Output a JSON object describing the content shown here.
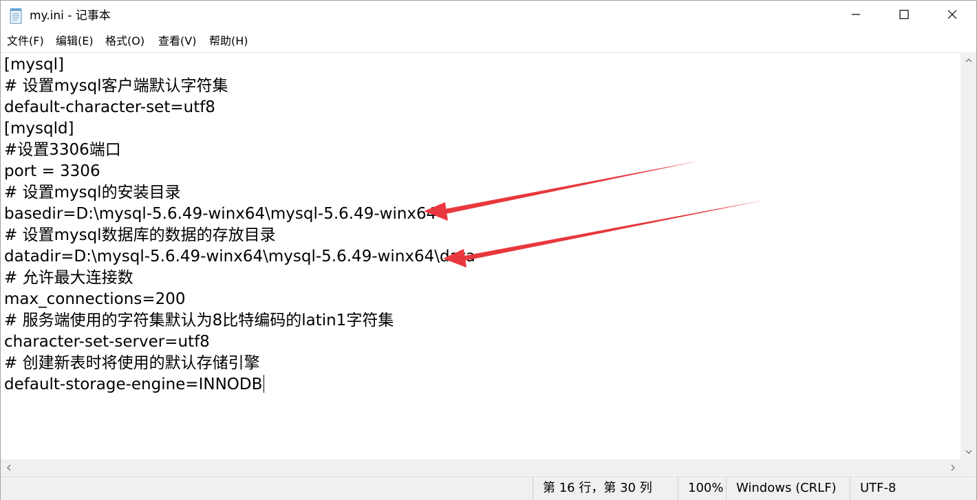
{
  "window": {
    "title": "my.ini - 记事本",
    "icon": "notepad-icon",
    "controls": [
      "minimize-icon",
      "maximize-icon",
      "close-icon"
    ]
  },
  "menu": {
    "items": [
      {
        "label": "文件(F)"
      },
      {
        "label": "编辑(E)"
      },
      {
        "label": "格式(O)"
      },
      {
        "label": "查看(V)"
      },
      {
        "label": "帮助(H)"
      }
    ]
  },
  "editor": {
    "lines": [
      "[mysql]",
      "# 设置mysql客户端默认字符集",
      "default-character-set=utf8",
      "[mysqld]",
      "#设置3306端口",
      "port = 3306",
      "# 设置mysql的安装目录",
      "basedir=D:\\mysql-5.6.49-winx64\\mysql-5.6.49-winx64",
      "# 设置mysql数据库的数据的存放目录",
      "datadir=D:\\mysql-5.6.49-winx64\\mysql-5.6.49-winx64\\data",
      "# 允许最大连接数",
      "max_connections=200",
      "# 服务端使用的字符集默认为8比特编码的latin1字符集",
      "character-set-server=utf8",
      "# 创建新表时将使用的默认存储引擎",
      "default-storage-engine=INNODB"
    ],
    "annotation_color": "#e8383d"
  },
  "status": {
    "position": "第 16 行，第 30 列",
    "zoom": "100%",
    "line_ending": "Windows (CRLF)",
    "encoding": "UTF-8"
  }
}
